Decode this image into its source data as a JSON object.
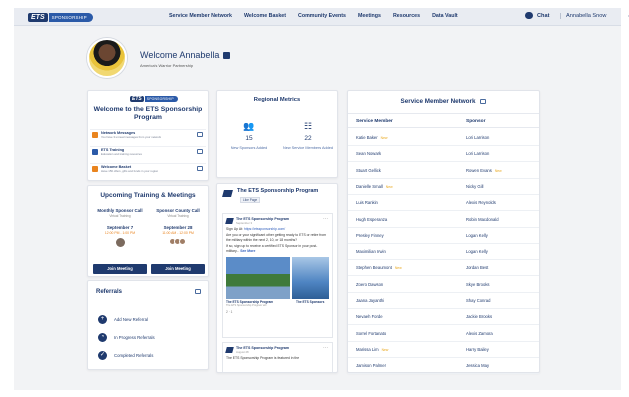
{
  "topbar": {
    "logo_ets": "ETS",
    "logo_sponsorship": "SPONSORSHIP",
    "nav": [
      "Service Member Network",
      "Welcome Basket",
      "Community Events",
      "Meetings",
      "Resources",
      "Data Vault"
    ],
    "chat_label": "Chat",
    "user_name": "Annabella Snow"
  },
  "profile": {
    "welcome": "Welcome Annabella",
    "organization": "America's Warrior Partnership"
  },
  "welcome_card": {
    "logo_ets": "ETS",
    "logo_sponsorship": "SPONSORSHIP",
    "title": "Welcome to the ETS Sponsorship Program",
    "items": [
      {
        "title": "Network Messages",
        "subtitle": "You have 3 unread messages from your network"
      },
      {
        "title": "ETS Training",
        "subtitle": "Education and training resources"
      },
      {
        "title": "Welcome Basket",
        "subtitle": "Have 156 offers, gifts and funds in your region"
      }
    ]
  },
  "training": {
    "title": "Upcoming Training & Meetings",
    "events": [
      {
        "name": "Monthly Sponsor Call",
        "venue": "Virtual Training",
        "date": "September 7",
        "time": "12:00 PM - 1:00 PM",
        "button": "Join Meeting"
      },
      {
        "name": "Sponsor County Call",
        "venue": "Virtual Training",
        "date": "September 28",
        "time": "11:00 AM - 12:00 PM",
        "button": "Join Meeting"
      }
    ]
  },
  "referrals": {
    "title": "Referrals",
    "items": [
      {
        "icon": "+",
        "label": "Add New Referral"
      },
      {
        "icon": "◔",
        "label": "In Progress Referrals"
      },
      {
        "icon": "✓",
        "label": "Completed Referrals"
      }
    ]
  },
  "regional_metrics": {
    "title": "Regional Metrics",
    "metrics": [
      {
        "icon": "people-icon",
        "value": "15",
        "label": "New Sponsors Added"
      },
      {
        "icon": "network-icon",
        "value": "22",
        "label": "New Service Members Added"
      }
    ]
  },
  "feed": {
    "title": "The ETS Sponsorship Program",
    "like_label": "Like Page",
    "posts": [
      {
        "author": "The ETS Sponsorship Program",
        "date": "September 3",
        "text_1": "Sign Up At: ",
        "link": "https://etssponsorship.com/",
        "text_2": "Are you or your significant other getting ready to ETS or retire from the military within the next 2, 10, or 18 months?",
        "text_3": "If so, sign up to receive a certified ETS Sponsor in your post-military... ",
        "see_more": "See More",
        "caption_1": "The ETS Sponsorship Program",
        "caption_1_sub": "The ETS Sponsorship Program will",
        "caption_2": "The ETS Sponsors",
        "reactions": "2 · 1"
      },
      {
        "author": "The ETS Sponsorship Program",
        "date": "August 28",
        "text_1": "The ETS Sponsorship Program is featured in the"
      }
    ]
  },
  "network": {
    "title": "Service Member Network",
    "col_member": "Service Member",
    "col_sponsor": "Sponsor",
    "rows": [
      {
        "member": "Katie Baker",
        "member_tag": "New",
        "sponsor": "Lori Larrison",
        "sponsor_tag": ""
      },
      {
        "member": "Sean Nowark",
        "member_tag": "",
        "sponsor": "Lori Larrison",
        "sponsor_tag": ""
      },
      {
        "member": "Stuart Gellick",
        "member_tag": "",
        "sponsor": "Rowen Evans",
        "sponsor_tag": "New"
      },
      {
        "member": "Danielle Small",
        "member_tag": "New",
        "sponsor": "Nicky Gill",
        "sponsor_tag": ""
      },
      {
        "member": "Luis Rankin",
        "member_tag": "",
        "sponsor": "Alexis Reynolds",
        "sponsor_tag": ""
      },
      {
        "member": "Hugh Esperanza",
        "member_tag": "",
        "sponsor": "Robin Macdonald",
        "sponsor_tag": ""
      },
      {
        "member": "Presley Finney",
        "member_tag": "",
        "sponsor": "Logan Kelly",
        "sponsor_tag": ""
      },
      {
        "member": "Maximilian Irwin",
        "member_tag": "",
        "sponsor": "Logan Kelly",
        "sponsor_tag": ""
      },
      {
        "member": "Stephen Beaumont",
        "member_tag": "New",
        "sponsor": "Jordan Best",
        "sponsor_tag": ""
      },
      {
        "member": "Zoero Dawson",
        "member_tag": "",
        "sponsor": "Skye Brooks",
        "sponsor_tag": ""
      },
      {
        "member": "Jaana Jayanthi",
        "member_tag": "",
        "sponsor": "Shay Conrad",
        "sponsor_tag": ""
      },
      {
        "member": "Nevaeh Forde",
        "member_tag": "",
        "sponsor": "Jackie Brooks",
        "sponsor_tag": ""
      },
      {
        "member": "Sorrel Fortanato",
        "member_tag": "",
        "sponsor": "Alexis Zamora",
        "sponsor_tag": ""
      },
      {
        "member": "Marissa Lim",
        "member_tag": "New",
        "sponsor": "Harry Bailey",
        "sponsor_tag": ""
      },
      {
        "member": "Jamison Palmer",
        "member_tag": "",
        "sponsor": "Jessica May",
        "sponsor_tag": ""
      }
    ]
  },
  "colors": {
    "navy": "#1f3a6e",
    "accent_orange": "#e9841f",
    "new_tag": "#e9a81f"
  }
}
